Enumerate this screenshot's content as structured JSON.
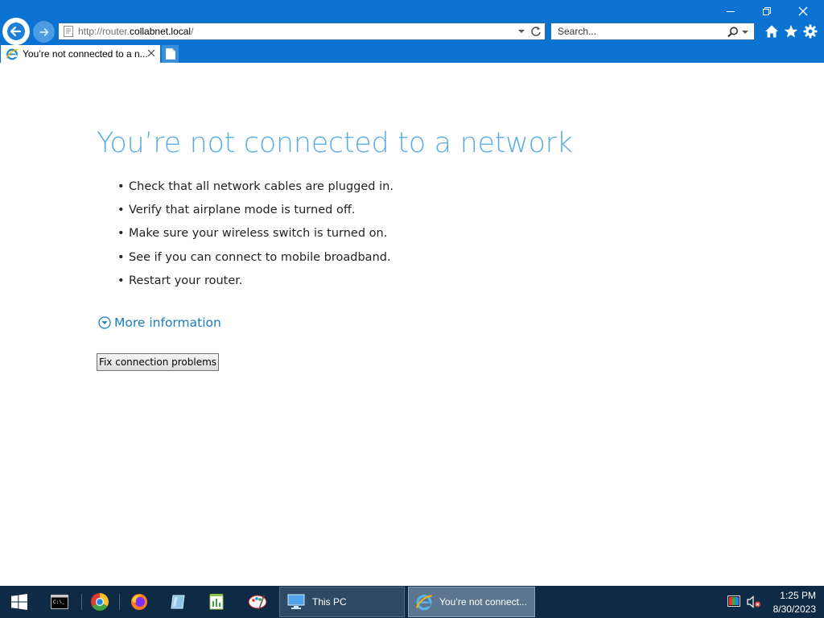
{
  "window": {
    "minimize_label": "Minimize",
    "restore_label": "Restore",
    "close_label": "Close"
  },
  "address_bar": {
    "url_prefix": "http://router.",
    "url_domain": "collabnet.local",
    "url_suffix": "/"
  },
  "search": {
    "placeholder": "Search..."
  },
  "tab": {
    "title": "You’re not connected to a n..."
  },
  "page": {
    "heading": "You’re not connected to a network",
    "tips": [
      "Check that all network cables are plugged in.",
      "Verify that airplane mode is turned off.",
      "Make sure your wireless switch is turned on.",
      "See if you can connect to mobile broadband.",
      "Restart your router."
    ],
    "bullet": "•",
    "more_info_label": "More information",
    "fix_button_label": "Fix connection problems"
  },
  "taskbar": {
    "pinned": [
      "windows-start-icon",
      "terminal-icon",
      "chrome-icon",
      "firefox-icon",
      "notepad-icon",
      "chart-app-icon",
      "paint-app-icon"
    ],
    "tasks": [
      {
        "label": "This PC",
        "icon": "this-pc-icon",
        "active": false
      },
      {
        "label": "You’re not connect...",
        "icon": "internet-explorer-icon",
        "active": true
      }
    ],
    "time": "1:25 PM",
    "date": "8/30/2023"
  },
  "colors": {
    "titlebar": "#0a73d1",
    "heading": "#5aaee3",
    "link": "#1a7dc2",
    "taskbar": "#0f2a44"
  }
}
